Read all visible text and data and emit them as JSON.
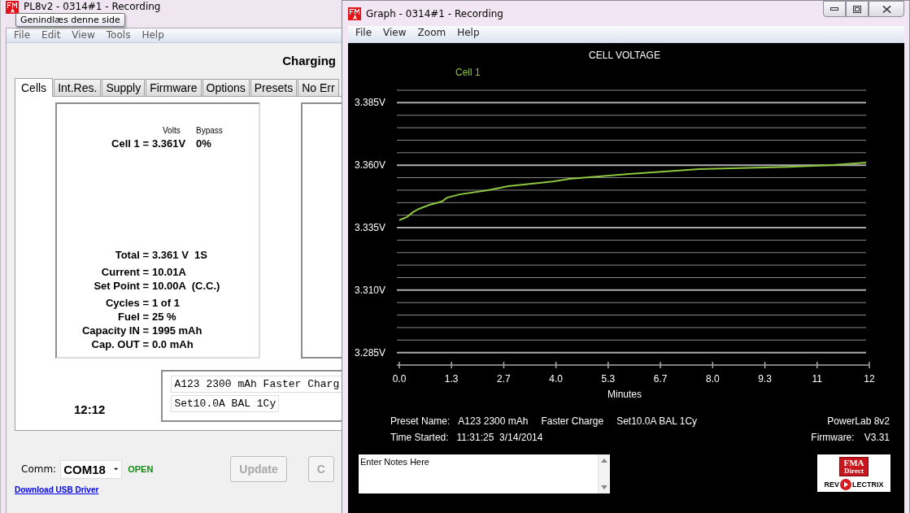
{
  "main_window": {
    "title": "PL8v2 - 0314#1 - Recording",
    "tooltip": "Genindlæs denne side",
    "menu": [
      "File",
      "Edit",
      "View",
      "Tools",
      "Help"
    ],
    "status": "Charging",
    "tabs": [
      {
        "label": "Cells",
        "selected": true
      },
      {
        "label": "Int.Res.",
        "selected": false
      },
      {
        "label": "Supply",
        "selected": false
      },
      {
        "label": "Firmware",
        "selected": false
      },
      {
        "label": "Options",
        "selected": false
      },
      {
        "label": "Presets",
        "selected": false
      },
      {
        "label": "No Err",
        "selected": false
      }
    ],
    "cell_headers": [
      "Volts",
      "Bypass"
    ],
    "cells": [
      {
        "label": "Cell 1 =",
        "volts": "3.361V",
        "bypass": "0%"
      }
    ],
    "stat_groups": [
      {
        "rows": [
          {
            "label": "Total =",
            "value": "3.361 V  1S"
          }
        ]
      },
      {
        "rows": [
          {
            "label": "Current =",
            "value": "10.01A"
          },
          {
            "label": "Set Point =",
            "value": "10.00A  (C.C.)"
          }
        ]
      },
      {
        "rows": [
          {
            "label": "Cycles =",
            "value": "1 of 1"
          },
          {
            "label": "Fuel =",
            "value": "25 %"
          },
          {
            "label": "Capacity IN =",
            "value": "1995 mAh"
          },
          {
            "label": "Cap. OUT =",
            "value": "0.0 mAh"
          }
        ]
      }
    ],
    "timer": "12:12",
    "preset_fields": [
      "A123 2300 mAh Faster Charg",
      "Set10.0A BAL 1Cy"
    ],
    "comm_label": "Comm:",
    "comm_port": "COM18",
    "comm_state": "OPEN",
    "buttons": [
      {
        "label": "Update",
        "disabled": true
      },
      {
        "label": "C",
        "disabled": true
      }
    ],
    "driver_link": "Download USB Driver"
  },
  "graph_window": {
    "title": "Graph - 0314#1 - Recording",
    "menu": [
      "File",
      "View",
      "Zoom",
      "Help"
    ],
    "chart_data": {
      "type": "line",
      "grid": true,
      "title": "CELL VOLTAGE",
      "xlabel": "Minutes",
      "x": [
        0,
        0.19,
        0.35,
        0.5,
        0.77,
        1.08,
        1.22,
        1.54,
        2.26,
        2.78,
        3.92,
        4.34,
        5.79,
        7.66,
        9.94,
        10.98,
        11.92
      ],
      "series": [
        {
          "name": "Cell 1",
          "color": "#8cc63f",
          "values": [
            3.338,
            3.3392,
            3.3412,
            3.3425,
            3.3441,
            3.3454,
            3.347,
            3.3483,
            3.35,
            3.3516,
            3.3535,
            3.3545,
            3.3564,
            3.3584,
            3.3593,
            3.36,
            3.361
          ]
        }
      ],
      "xlim": [
        0,
        12
      ],
      "ylim": [
        3.28,
        3.39
      ],
      "xticks": [
        {
          "value": 0,
          "label": "0.0"
        },
        {
          "value": 1.333,
          "label": "1.3"
        },
        {
          "value": 2.667,
          "label": "2.7"
        },
        {
          "value": 4,
          "label": "4.0"
        },
        {
          "value": 5.333,
          "label": "5.3"
        },
        {
          "value": 6.667,
          "label": "6.7"
        },
        {
          "value": 8,
          "label": "8.0"
        },
        {
          "value": 9.333,
          "label": "9.3"
        },
        {
          "value": 10.667,
          "label": "11"
        },
        {
          "value": 12,
          "label": "12"
        }
      ],
      "yticks": [
        {
          "value": 3.285,
          "label": "3.285V"
        },
        {
          "value": 3.31,
          "label": "3.310V"
        },
        {
          "value": 3.335,
          "label": "3.335V"
        },
        {
          "value": 3.36,
          "label": "3.360V"
        },
        {
          "value": 3.385,
          "label": "3.385V"
        }
      ]
    },
    "preset_label": "Preset Name:",
    "preset_values": [
      "A123 2300 mAh",
      "Faster Charge",
      "Set10.0A BAL 1Cy"
    ],
    "time_label": "Time Started:",
    "time_value": "11:31:25  3/14/2014",
    "device": "PowerLab 8v2",
    "firmware_label": "Firmware:",
    "firmware_value": "V3.31",
    "notes": "Enter Notes Here",
    "logo": {
      "top": "FMA",
      "middle": "Direct",
      "left": "REV",
      "right": "LECTRIX"
    }
  }
}
